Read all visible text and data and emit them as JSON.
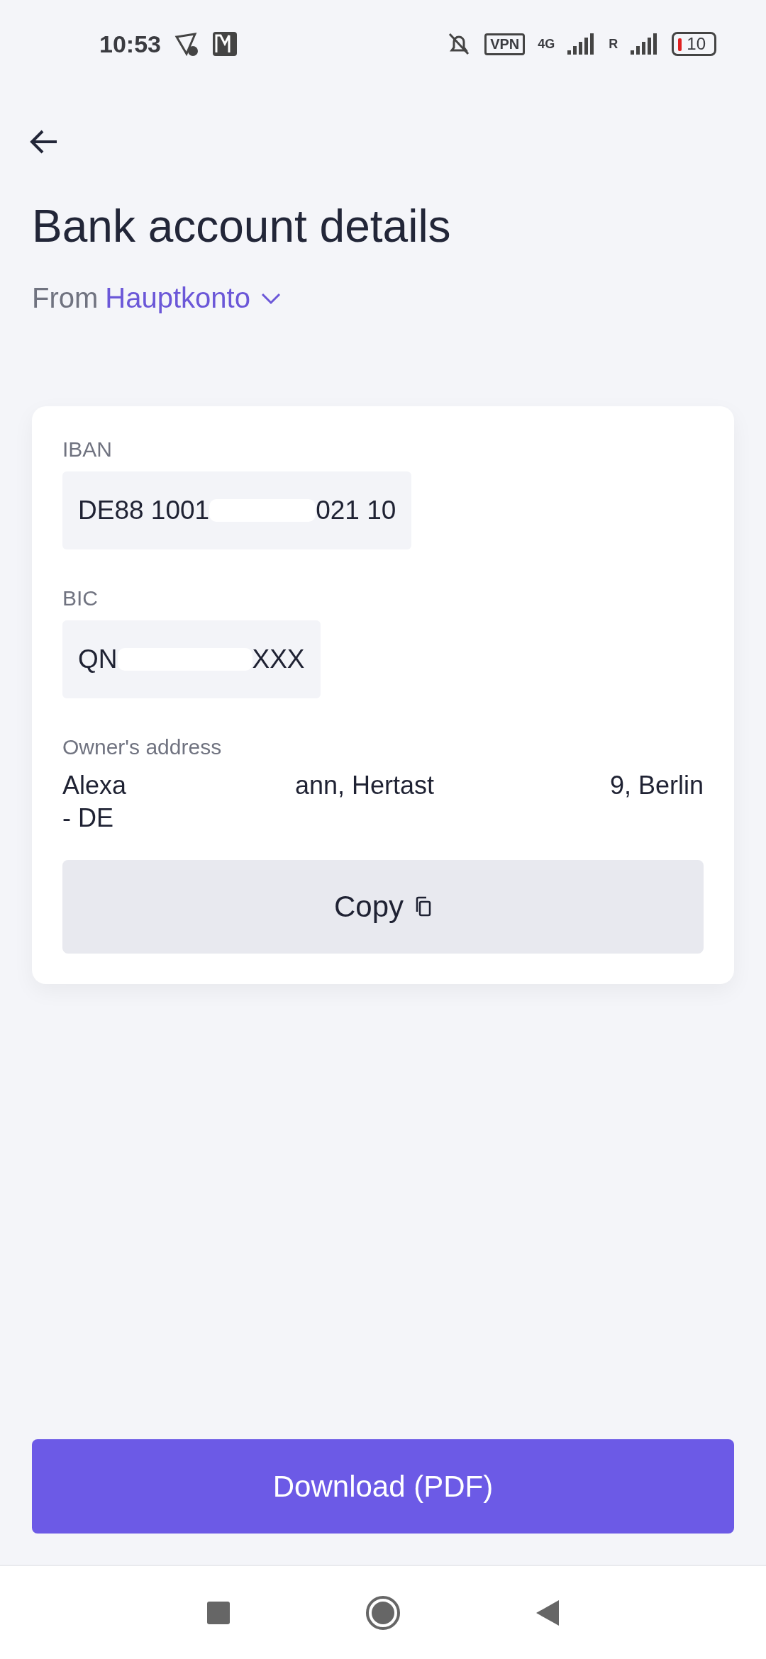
{
  "status_bar": {
    "time": "10:53",
    "network": "4G",
    "roaming": "R",
    "vpn": "VPN",
    "battery": "10"
  },
  "header": {
    "title": "Bank account details",
    "from_label": "From",
    "account": "Hauptkonto"
  },
  "card": {
    "fields": [
      {
        "label": "IBAN",
        "parts": [
          "DE88 1001",
          "021 10"
        ]
      },
      {
        "label": "BIC",
        "parts": [
          "QN",
          "XXX"
        ]
      }
    ],
    "address": {
      "label": "Owner's address",
      "line_parts": [
        "Alexa",
        "ann, Hertast",
        "9, Berlin"
      ],
      "line2": "- DE"
    },
    "copy_button": "Copy"
  },
  "download_button": "Download (PDF)"
}
